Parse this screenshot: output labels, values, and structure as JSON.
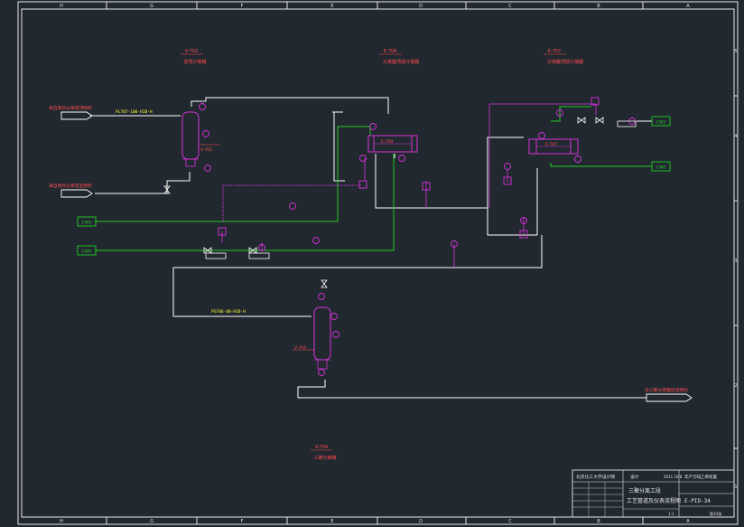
{
  "drawing": {
    "col_labels": [
      "H",
      "G",
      "F",
      "E",
      "D",
      "C",
      "B",
      "A"
    ],
    "row_labels": [
      "5",
      "4",
      "3",
      "2",
      "1"
    ],
    "equipment_tags": [
      {
        "tag": "V-703",
        "desc": "釜残分离罐"
      },
      {
        "tag": "E-708",
        "desc": "分离器顶部冷凝器"
      },
      {
        "tag": "E-707",
        "desc": "分离器顶部冷凝器"
      },
      {
        "tag": "V-704",
        "desc": "三聚分离罐"
      }
    ],
    "inline_tags": {
      "v703": "V-703",
      "e708": "E-708",
      "e707": "E-707",
      "v704": "V-704"
    },
    "line_numbers": {
      "pl707": "PL707-100-H1B-H",
      "pg706": "PG706-80-H1B-H"
    },
    "stream_labels": {
      "left_in_1": "来自换热分离塔顶物料",
      "left_in_2": "来自换热分离塔釜物料",
      "right_out": "去三聚分离罐后续物料"
    },
    "utility_boxes": {
      "cws_1": "CWS",
      "cwr_1": "CWR",
      "cws_2": "CWS",
      "cwr_2": "CWR"
    },
    "title_block": {
      "company": "北京化工大学设计院",
      "category": "设计",
      "date": "2011.10.8",
      "project": "年产万吨乙烯装置",
      "title_line1": "三聚分离工段",
      "title_line2": "工艺管道及仪表流程图",
      "drawing_no": "E-PID-34",
      "scale": "1:1",
      "sheet": "第34张"
    }
  },
  "colors": {
    "background": "#212830",
    "frame": "#e6e6e6",
    "process_line": "#ffffff",
    "cooling_water": "#22cc22",
    "instrument": "#d633d6",
    "label_red": "#ff4d4d",
    "label_yellow": "#ffff33"
  }
}
